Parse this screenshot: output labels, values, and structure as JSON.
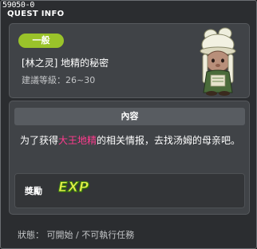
{
  "window": {
    "quest_id": "59050-0",
    "title": "QUEST INFO"
  },
  "header": {
    "category": "一般",
    "quest_name": "[林之灵] 地精的秘密",
    "level_requirement": "建議等級：26~30"
  },
  "content": {
    "section_title": "內容",
    "description_prefix": "为了获得",
    "description_highlight": "大王地精",
    "description_suffix": "的相关情报，去找汤姆的母亲吧。",
    "highlight_color": "#ff3b8e"
  },
  "reward": {
    "label": "獎勵",
    "icon_text": "EXP",
    "icon": "exp-icon"
  },
  "status": {
    "text": "狀態： 可開始 / 不可執行任務"
  },
  "colors": {
    "badge": "#9ac32a",
    "window_bg": "#2b2d30",
    "card_bg": "#404347"
  }
}
